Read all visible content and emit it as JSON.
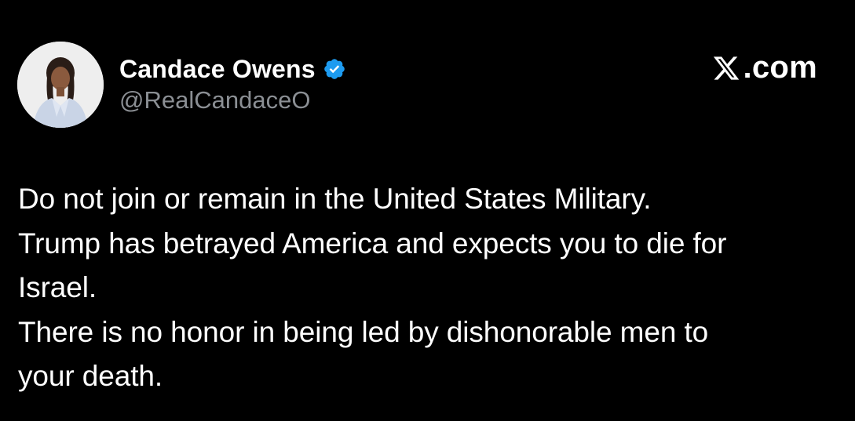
{
  "author": {
    "name": "Candace Owens",
    "handle": "@RealCandaceO",
    "verified": true,
    "avatar_icon": "profile-photo-avatar"
  },
  "branding": {
    "site_text": ".com",
    "logo_icon": "x-logo-icon"
  },
  "tweet": {
    "lines": [
      "Do not join or remain in the United States Military.",
      "Trump has betrayed America and expects you to die for",
      "Israel.",
      "There is no honor in being led by dishonorable men to",
      "your death."
    ]
  },
  "colors": {
    "background": "#000000",
    "text_primary": "#ffffff",
    "text_secondary": "#8b8f94",
    "verified_badge": "#1d9bf0"
  }
}
